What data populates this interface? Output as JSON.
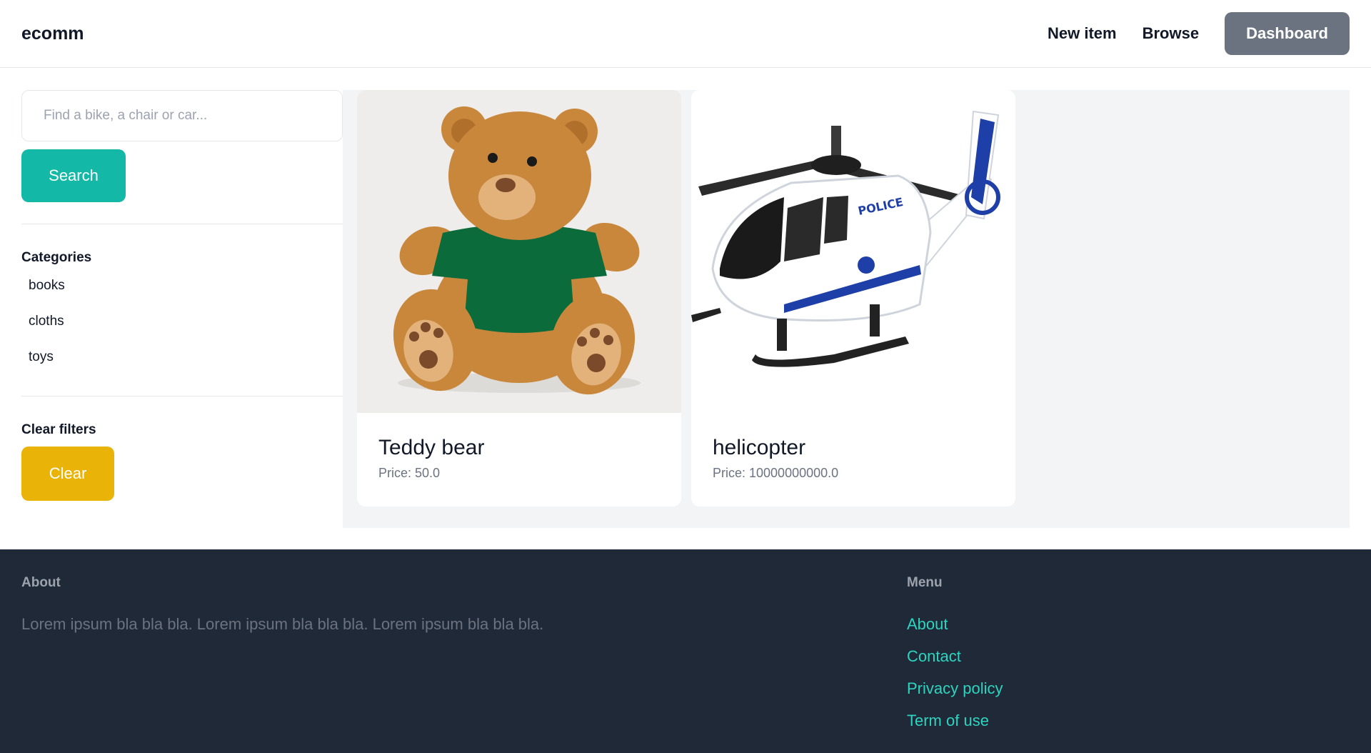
{
  "navbar": {
    "brand": "ecomm",
    "links": [
      "New item",
      "Browse"
    ],
    "dashboard_label": "Dashboard"
  },
  "search": {
    "placeholder": "Find a bike, a chair or car...",
    "button_label": "Search"
  },
  "categories": {
    "title": "Categories",
    "items": [
      "books",
      "cloths",
      "toys"
    ]
  },
  "filters": {
    "title": "Clear filters",
    "button_label": "Clear"
  },
  "products": [
    {
      "name": "Teddy bear",
      "price": "Price: 50.0",
      "image": "teddy-bear"
    },
    {
      "name": "helicopter",
      "price": "Price: 10000000000.0",
      "image": "police-helicopter"
    }
  ],
  "footer": {
    "about_title": "About",
    "about_text": "Lorem ipsum bla bla bla. Lorem ipsum bla bla bla. Lorem ipsum bla bla bla.",
    "menu_title": "Menu",
    "menu_links": [
      "About",
      "Contact",
      "Privacy policy",
      "Term of use"
    ]
  },
  "colors": {
    "search_button": "#14b8a6",
    "clear_button": "#eab308",
    "dashboard_button": "#6b7280",
    "footer_bg": "#1f2937",
    "footer_link": "#2dd4bf"
  }
}
